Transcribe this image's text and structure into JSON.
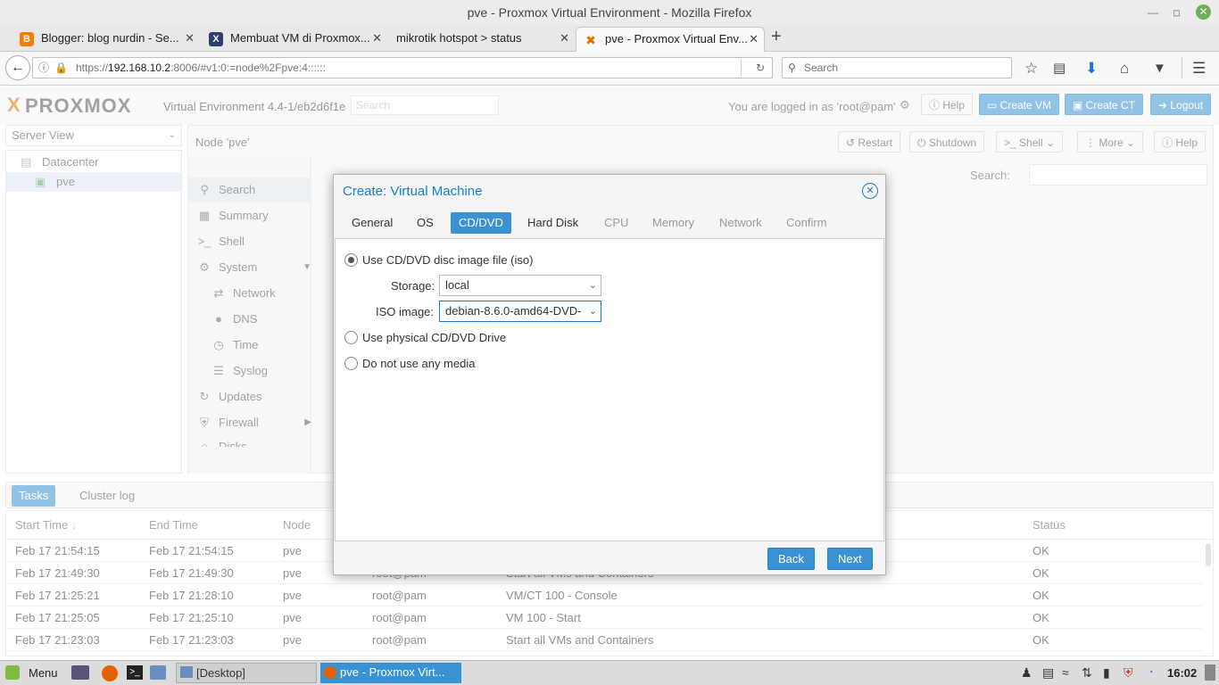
{
  "window_title": "pve - Proxmox Virtual Environment - Mozilla Firefox",
  "browser": {
    "tabs": [
      {
        "label": "Blogger: blog nurdin - Se..."
      },
      {
        "label": "Membuat VM di Proxmox..."
      },
      {
        "label": "mikrotik hotspot > status"
      },
      {
        "label": "pve - Proxmox Virtual Env..."
      }
    ],
    "url_prefix": "https://",
    "url_host": "192.168.10.2",
    "url_rest": ":8006/#v1:0:=node%2Fpve:4::::::",
    "search_placeholder": "Search"
  },
  "pve": {
    "logo": "PROXMOX",
    "version": "Virtual Environment 4.4-1/eb2d6f1e",
    "search_placeholder": "Search",
    "logged_in": "You are logged in as 'root@pam'",
    "help": "Help",
    "create_vm": "Create VM",
    "create_ct": "Create CT",
    "logout": "Logout",
    "server_view": "Server View",
    "tree": {
      "datacenter": "Datacenter",
      "node": "pve"
    },
    "node_title": "Node 'pve'",
    "node_buttons": {
      "restart": "Restart",
      "shutdown": "Shutdown",
      "shell": "Shell",
      "more": "More",
      "help": "Help"
    },
    "menu": [
      "Search",
      "Summary",
      "Shell",
      "System",
      "Network",
      "DNS",
      "Time",
      "Syslog",
      "Updates",
      "Firewall",
      "Disks"
    ],
    "search_label": "Search:",
    "tasks_tab": "Tasks",
    "cluster_log_tab": "Cluster log",
    "task_columns": [
      "Start Time",
      "End Time",
      "Node",
      "",
      "",
      "Status"
    ],
    "task_rows": [
      [
        "Feb 17 21:54:15",
        "Feb 17 21:54:15",
        "pve",
        "",
        "",
        "OK"
      ],
      [
        "Feb 17 21:49:30",
        "Feb 17 21:49:30",
        "pve",
        "root@pam",
        "Start all VMs and Containers",
        "OK"
      ],
      [
        "Feb 17 21:25:21",
        "Feb 17 21:28:10",
        "pve",
        "root@pam",
        "VM/CT 100 - Console",
        "OK"
      ],
      [
        "Feb 17 21:25:05",
        "Feb 17 21:25:10",
        "pve",
        "root@pam",
        "VM 100 - Start",
        "OK"
      ],
      [
        "Feb 17 21:23:03",
        "Feb 17 21:23:03",
        "pve",
        "root@pam",
        "Start all VMs and Containers",
        "OK"
      ]
    ]
  },
  "dialog": {
    "title": "Create: Virtual Machine",
    "tabs": [
      "General",
      "OS",
      "CD/DVD",
      "Hard Disk",
      "CPU",
      "Memory",
      "Network",
      "Confirm"
    ],
    "opt_iso": "Use CD/DVD disc image file (iso)",
    "storage_label": "Storage:",
    "storage_value": "local",
    "iso_label": "ISO image:",
    "iso_value": "debian-8.6.0-amd64-DVD-",
    "opt_physical": "Use physical CD/DVD Drive",
    "opt_none": "Do not use any media",
    "back": "Back",
    "next": "Next"
  },
  "taskbar": {
    "menu": "Menu",
    "desktop": "[Desktop]",
    "firefox": "pve - Proxmox Virt...",
    "clock": "16:02"
  }
}
